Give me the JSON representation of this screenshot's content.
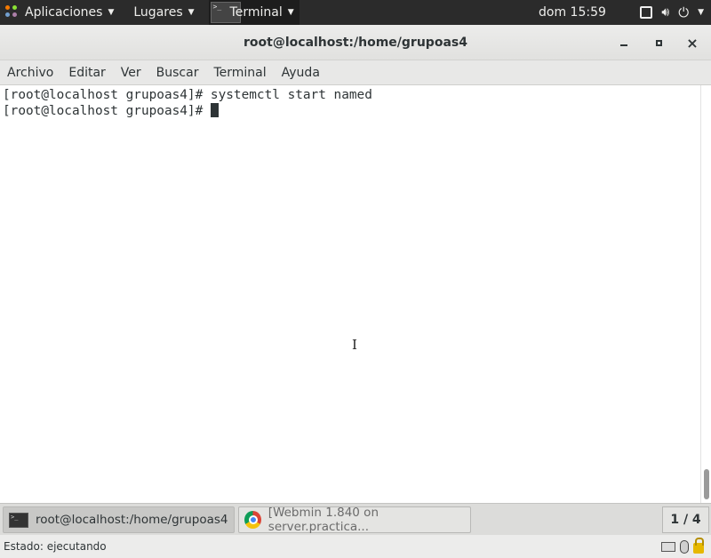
{
  "topbar": {
    "apps_label": "Aplicaciones",
    "places_label": "Lugares",
    "active_app_label": "Terminal",
    "clock": "dom 15:59"
  },
  "window": {
    "title": "root@localhost:/home/grupoas4",
    "minimize_symbol": "_",
    "maximize_symbol": "□",
    "close_symbol": "×"
  },
  "menubar": {
    "items": [
      {
        "label": "Archivo"
      },
      {
        "label": "Editar"
      },
      {
        "label": "Ver"
      },
      {
        "label": "Buscar"
      },
      {
        "label": "Terminal"
      },
      {
        "label": "Ayuda"
      }
    ]
  },
  "terminal": {
    "lines": [
      "[root@localhost grupoas4]# systemctl start named",
      "[root@localhost grupoas4]# "
    ]
  },
  "taskbar": {
    "tasks": [
      {
        "label": "root@localhost:/home/grupoas4",
        "active": true
      },
      {
        "label": "[Webmin 1.840 on server.practica...",
        "active": false
      }
    ],
    "workspace": "1 / 4"
  },
  "statusbar": {
    "text": "Estado: ejecutando"
  }
}
